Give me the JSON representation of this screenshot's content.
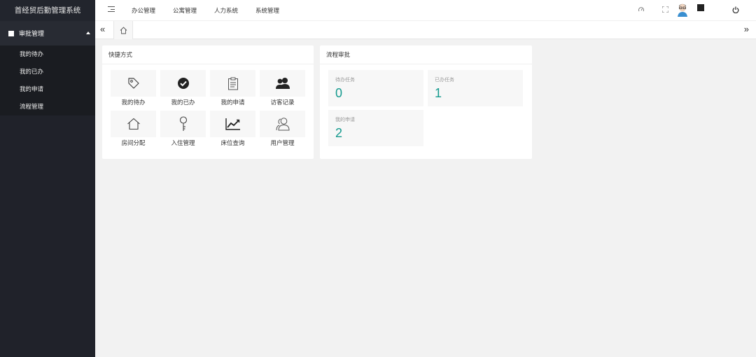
{
  "app_title": "首经贸后勤管理系统",
  "sidebar": {
    "group_label": "审批管理",
    "items": [
      {
        "label": "我的待办"
      },
      {
        "label": "我的已办"
      },
      {
        "label": "我的申请"
      },
      {
        "label": "流程管理"
      }
    ]
  },
  "header": {
    "nav": [
      {
        "label": "办公管理"
      },
      {
        "label": "公寓管理"
      },
      {
        "label": "人力系统"
      },
      {
        "label": "系统管理"
      }
    ]
  },
  "tabs": {
    "prev_glyph": "«",
    "next_glyph": "»"
  },
  "shortcuts": {
    "title": "快捷方式",
    "items": [
      {
        "label": "我的待办",
        "icon": "tag-icon"
      },
      {
        "label": "我的已办",
        "icon": "check-circle-icon"
      },
      {
        "label": "我的申请",
        "icon": "clipboard-icon"
      },
      {
        "label": "访客记录",
        "icon": "users-icon"
      },
      {
        "label": "房间分配",
        "icon": "home-icon"
      },
      {
        "label": "入住管理",
        "icon": "key-icon"
      },
      {
        "label": "床位查询",
        "icon": "line-chart-icon"
      },
      {
        "label": "用户管理",
        "icon": "user-group-icon"
      }
    ]
  },
  "approval": {
    "title": "流程审批",
    "stats": [
      {
        "label": "待办任务",
        "value": "0"
      },
      {
        "label": "已办任务",
        "value": "1"
      },
      {
        "label": "我的申请",
        "value": "2"
      }
    ],
    "accent_color": "#159a8e"
  }
}
